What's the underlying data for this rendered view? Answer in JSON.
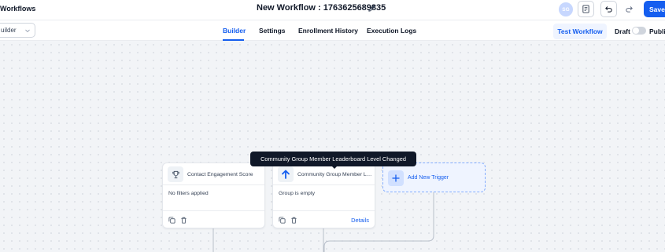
{
  "header": {
    "back_label": "Workflows",
    "workflow_title": "New Workflow : 1763625689835",
    "avatar_initials": "SG",
    "save_label": "Save"
  },
  "subheader": {
    "mode_select_value": "uilder",
    "tabs": [
      {
        "label": "Builder",
        "active": true
      },
      {
        "label": "Settings",
        "active": false
      },
      {
        "label": "Enrollment History",
        "active": false
      },
      {
        "label": "Execution Logs",
        "active": false
      }
    ],
    "test_button_label": "Test Workflow",
    "draft_label": "Draft",
    "publish_label": "Publish",
    "published": false
  },
  "canvas": {
    "tooltip_text": "Community Group Member Leaderboard Level Changed",
    "triggers": [
      {
        "icon": "trophy-icon",
        "title": "Contact Engagement Score",
        "body": "No filters applied",
        "details_label": ""
      },
      {
        "icon": "arrow-up-icon",
        "title": "Community Group Member Leaderboard Level Changed",
        "body": "Group is empty",
        "details_label": "Details"
      }
    ],
    "add_trigger_label": "Add New Trigger"
  },
  "colors": {
    "accent": "#155eef",
    "accent_light": "#eff4ff",
    "tooltip_bg": "#101828"
  }
}
